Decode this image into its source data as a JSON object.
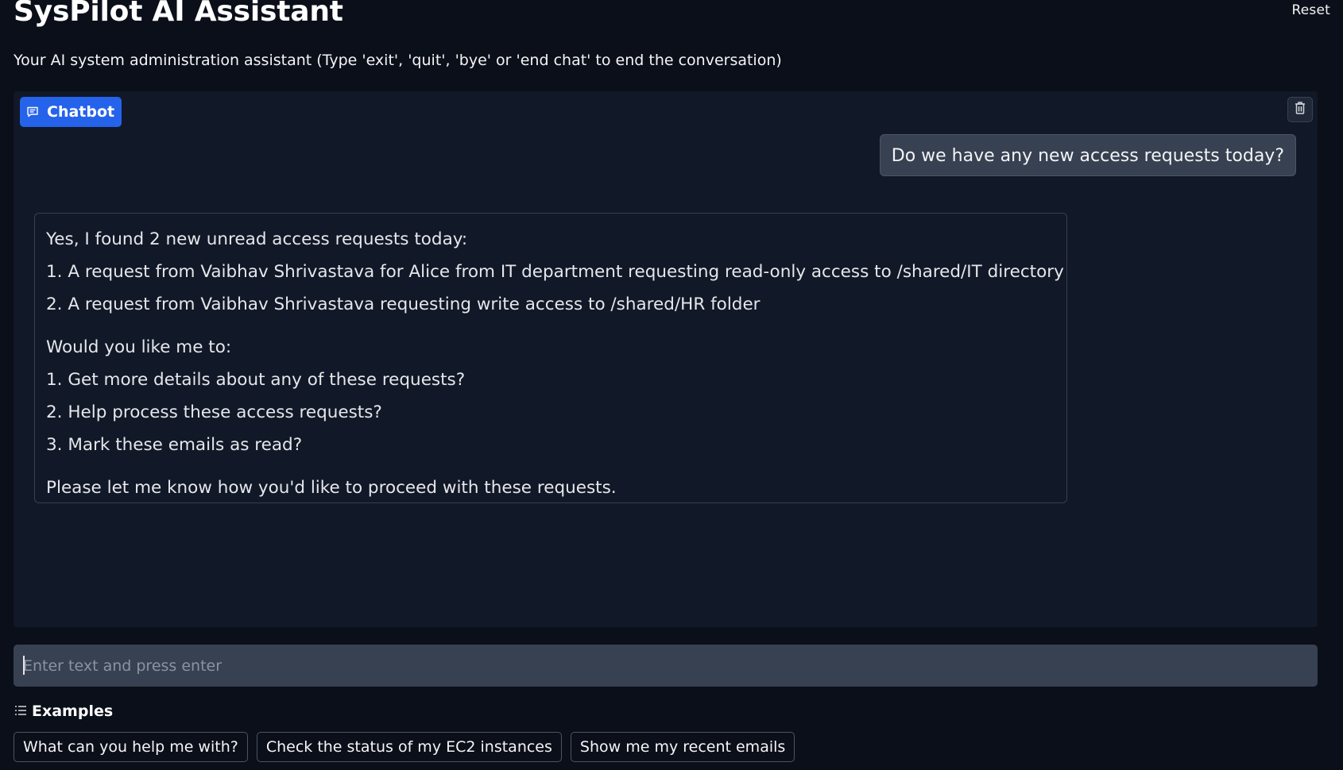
{
  "header": {
    "title": "SysPilot AI Assistant",
    "subtitle": "Your AI system administration assistant (Type 'exit', 'quit', 'bye' or 'end chat' to end the conversation)",
    "reset_label": "Reset"
  },
  "chat": {
    "badge_label": "Chatbot",
    "badge_icon": "chat-bubble-icon",
    "clear_icon": "trash-icon",
    "messages": [
      {
        "role": "user",
        "text": "Do we have any new access requests today?"
      },
      {
        "role": "assistant",
        "lines": [
          "Yes, I found 2 new unread access requests today:",
          "1. A request from Vaibhav Shrivastava for Alice from IT department requesting read-only access to /shared/IT directory",
          "2. A request from Vaibhav Shrivastava requesting write access to /shared/HR folder",
          "Would you like me to:",
          "1. Get more details about any of these requests?",
          "2. Help process these access requests?",
          "3. Mark these emails as read?",
          "Please let me know how you'd like to proceed with these requests."
        ]
      }
    ]
  },
  "input": {
    "placeholder": "Enter text and press enter",
    "value": ""
  },
  "examples": {
    "label": "Examples",
    "icon": "list-icon",
    "items": [
      "What can you help me with?",
      "Check the status of my EC2 instances",
      "Show me my recent emails"
    ]
  },
  "colors": {
    "background": "#0b0f19",
    "panel": "#111827",
    "accent": "#2563eb",
    "user_bubble": "#374151",
    "input_bg": "#374151",
    "border": "#374151"
  }
}
